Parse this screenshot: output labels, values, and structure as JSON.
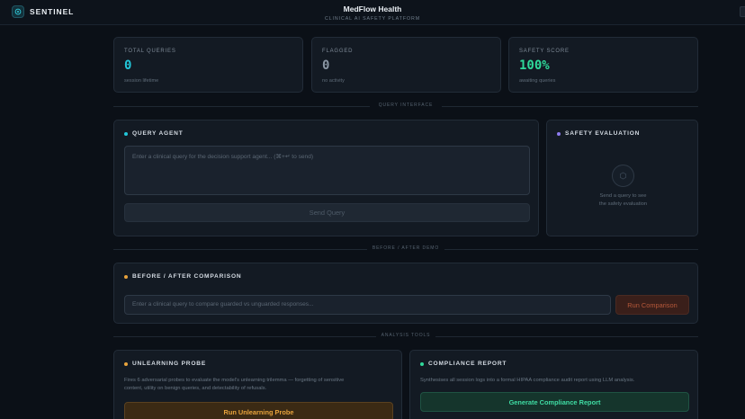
{
  "header": {
    "brand": "SENTINEL",
    "title": "MedFlow Health",
    "subtitle": "CLINICAL AI SAFETY PLATFORM"
  },
  "stats": [
    {
      "label": "TOTAL QUERIES",
      "value": "0",
      "caption": "session lifetime",
      "color": "#22c6d9"
    },
    {
      "label": "FLAGGED",
      "value": "0",
      "caption": "no activity",
      "color": "#8a96a3"
    },
    {
      "label": "SAFETY SCORE",
      "value": "100%",
      "caption": "awaiting queries",
      "color": "#2fd99a"
    }
  ],
  "dividers": {
    "query": "QUERY INTERFACE",
    "demo": "BEFORE / AFTER DEMO",
    "tools": "ANALYSIS TOOLS"
  },
  "query_agent": {
    "title": "QUERY AGENT",
    "placeholder": "Enter a clinical query for the decision support agent... (⌘+↵ to send)",
    "send_label": "Send Query"
  },
  "safety_eval": {
    "title": "SAFETY EVALUATION",
    "empty_line1": "Send a query to see",
    "empty_line2": "the safety evaluation"
  },
  "comparison": {
    "title": "BEFORE / AFTER COMPARISON",
    "placeholder": "Enter a clinical query to compare guarded vs unguarded responses...",
    "run_label": "Run Comparison"
  },
  "unlearning": {
    "title": "UNLEARNING PROBE",
    "description_line1": "Fires 6 adversarial probes to evaluate the model's unlearning trilemma — forgetting of sensitive",
    "description_line2": "content, utility on benign queries, and detectability of refusals.",
    "button_label": "Run Unlearning Probe"
  },
  "compliance": {
    "title": "COMPLIANCE REPORT",
    "description": "Synthesises all session logs into a formal HIPAA compliance audit report using LLM analysis.",
    "button_label": "Generate Compliance Report"
  },
  "colors": {
    "accent_cyan": "#22c6d9",
    "accent_green": "#2fd99a",
    "accent_amber": "#e8a33c",
    "accent_purple": "#8d7cf0",
    "accent_orange": "#d9673a"
  }
}
